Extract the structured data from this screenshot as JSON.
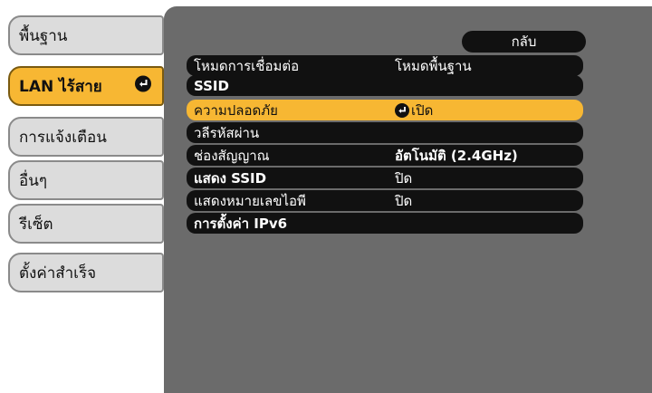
{
  "sidebar": {
    "items": [
      {
        "label": "พื้นฐาน",
        "active": false
      },
      {
        "label": "LAN ไร้สาย",
        "active": true
      },
      {
        "label": "การแจ้งเตือน",
        "active": false
      },
      {
        "label": "อื่นๆ",
        "active": false
      },
      {
        "label": "รีเซ็ต",
        "active": false
      },
      {
        "label": "ตั้งค่าสำเร็จ",
        "active": false
      }
    ]
  },
  "main": {
    "back_label": "กลับ",
    "rows": [
      {
        "label": "โหมดการเชื่อมต่อ",
        "value": "โหมดพื้นฐาน"
      },
      {
        "label": "SSID",
        "value": ""
      },
      {
        "label": "ความปลอดภัย",
        "value": "เปิด",
        "selected": true,
        "icon": "enter-icon"
      },
      {
        "label": "วลีรหัสผ่าน",
        "value": ""
      },
      {
        "label": "ช่องสัญญาณ",
        "value": "อัตโนมัติ (2.4GHz)"
      },
      {
        "label": "แสดง SSID",
        "value": "ปิด"
      },
      {
        "label": "แสดงหมายเลขไอพี",
        "value": "ปิด"
      },
      {
        "label": "การตั้งค่า IPv6",
        "value": ""
      }
    ]
  },
  "colors": {
    "accent": "#f7b733",
    "panel": "#6b6b6b",
    "row": "#111111",
    "tab": "#dcdcdc"
  }
}
